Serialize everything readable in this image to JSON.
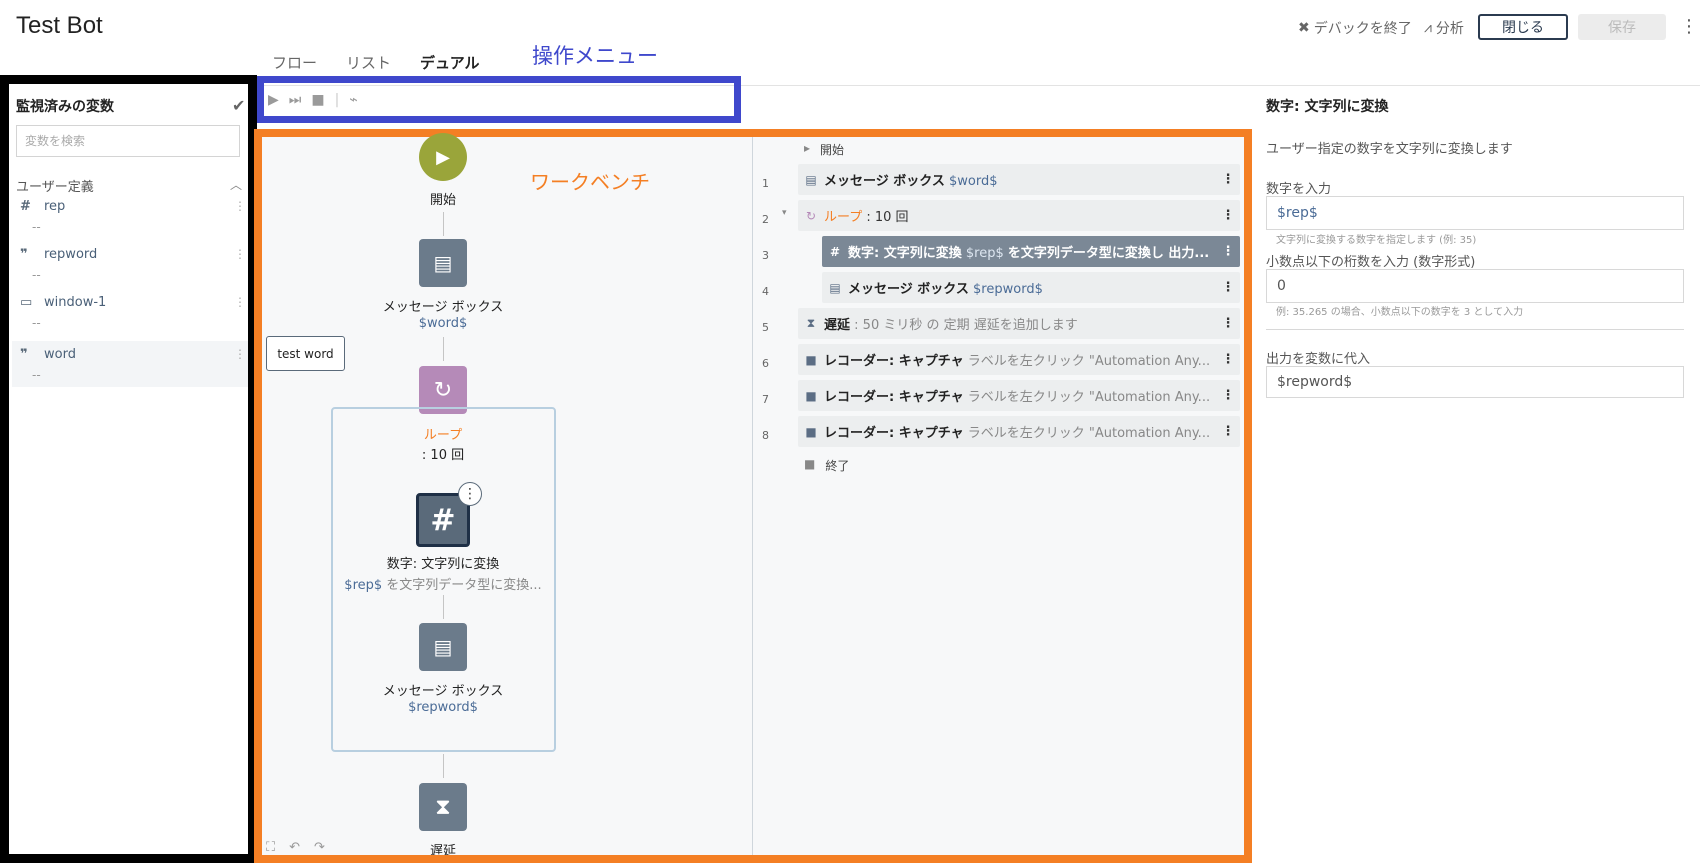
{
  "app": {
    "title": "Test Bot"
  },
  "view_tabs": [
    "フロー",
    "リスト",
    "デュアル"
  ],
  "annotations": {
    "menu": "操作メニュー",
    "workbench": "ワークベンチ"
  },
  "header": {
    "debug_end": "デバックを終了",
    "analyze": "分析",
    "close": "閉じる",
    "save": "保存"
  },
  "variables": {
    "title": "監視済みの変数",
    "search_placeholder": "変数を検索",
    "section": "ユーザー定義",
    "items": [
      {
        "name": "rep",
        "value": "--",
        "icon": "number-icon"
      },
      {
        "name": "repword",
        "value": "--",
        "icon": "quote-icon"
      },
      {
        "name": "window-1",
        "value": "--",
        "icon": "window-icon"
      },
      {
        "name": "word",
        "value": "--",
        "icon": "quote-icon"
      }
    ]
  },
  "flow": {
    "start_label": "開始",
    "msgbox1": {
      "label": "メッセージ ボックス",
      "var": "$word$"
    },
    "loop": {
      "label": "ループ",
      "count": ": 10 回"
    },
    "num_to_str": {
      "label": "数字: 文字列に変換",
      "var": "$rep$",
      "desc": "を文字列データ型に変換..."
    },
    "msgbox2": {
      "label": "メッセージ ボックス",
      "var": "$repword$"
    },
    "delay": {
      "label": "遅延"
    },
    "tooltip": "test word"
  },
  "list": {
    "start": "開始",
    "end": "終了",
    "rows": [
      {
        "num": "1",
        "title": "メッセージ ボックス",
        "var": "$word$",
        "rest": ""
      },
      {
        "num": "2",
        "title": "ループ",
        "var": "",
        "rest": ": 10 回"
      },
      {
        "num": "3",
        "title": "数字: 文字列に変換",
        "var": "$rep$",
        "rest": "を文字列データ型に変換し 出力..."
      },
      {
        "num": "4",
        "title": "メッセージ ボックス",
        "var": "$repword$",
        "rest": ""
      },
      {
        "num": "5",
        "title": "遅延",
        "var": "",
        "rest": ": 50 ミリ秒 の 定期 遅延を追加します"
      },
      {
        "num": "6",
        "title": "レコーダー: キャプチャ",
        "var": "",
        "rest": "ラベルを左クリック \"Automation Any..."
      },
      {
        "num": "7",
        "title": "レコーダー: キャプチャ",
        "var": "",
        "rest": "ラベルを左クリック \"Automation Any..."
      },
      {
        "num": "8",
        "title": "レコーダー: キャプチャ",
        "var": "",
        "rest": "ラベルを左クリック \"Automation Any..."
      }
    ]
  },
  "props": {
    "title": "数字: 文字列に変換",
    "desc": "ユーザー指定の数字を文字列に変換します",
    "input_label": "数字を入力",
    "input_value": "$rep$",
    "input_hint": "文字列に変換する数字を指定します (例: 35)",
    "decimal_label": "小数点以下の桁数を入力 (数字形式)",
    "decimal_value": "0",
    "decimal_hint": "例: 35.265 の場合、小数点以下の数字を 3 として入力",
    "output_label": "出力を変数に代入",
    "output_value": "$repword$"
  }
}
